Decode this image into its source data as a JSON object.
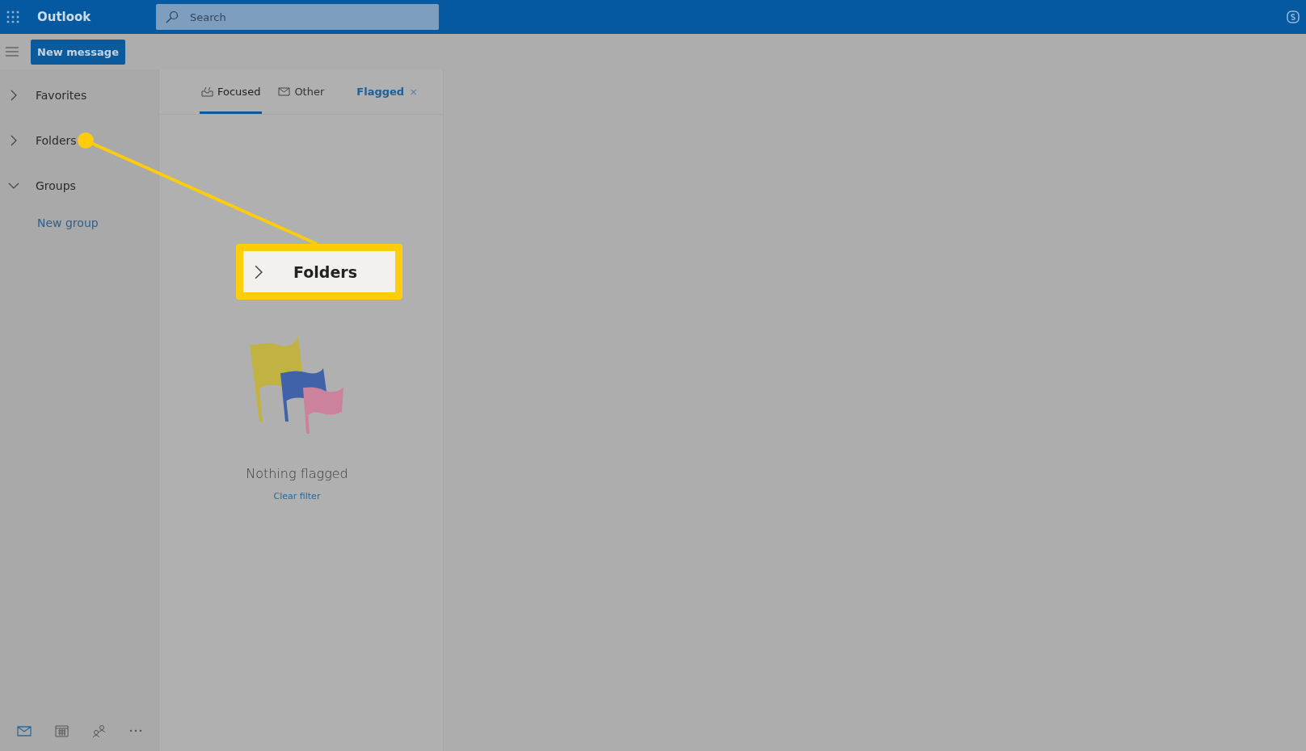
{
  "app_title": "Outlook",
  "search": {
    "placeholder": "Search"
  },
  "new_message_button": "New message",
  "sidebar": {
    "items": [
      {
        "label": "Favorites",
        "expanded": false
      },
      {
        "label": "Folders",
        "expanded": false
      },
      {
        "label": "Groups",
        "expanded": true,
        "children": [
          {
            "label": "New group"
          }
        ]
      }
    ]
  },
  "tabs": [
    {
      "label": "Focused",
      "kind": "focused",
      "selected": true
    },
    {
      "label": "Other",
      "kind": "other",
      "selected": false
    }
  ],
  "filter": {
    "label": "Flagged",
    "close": "×"
  },
  "empty_state": {
    "message": "Nothing flagged",
    "link": "Clear filter"
  },
  "callout": {
    "label": "Folders",
    "expanded": false
  },
  "bottom_nav": [
    {
      "kind": "mail",
      "selected": true
    },
    {
      "kind": "calendar",
      "selected": false
    },
    {
      "kind": "people",
      "selected": false
    },
    {
      "kind": "more",
      "selected": false
    }
  ]
}
